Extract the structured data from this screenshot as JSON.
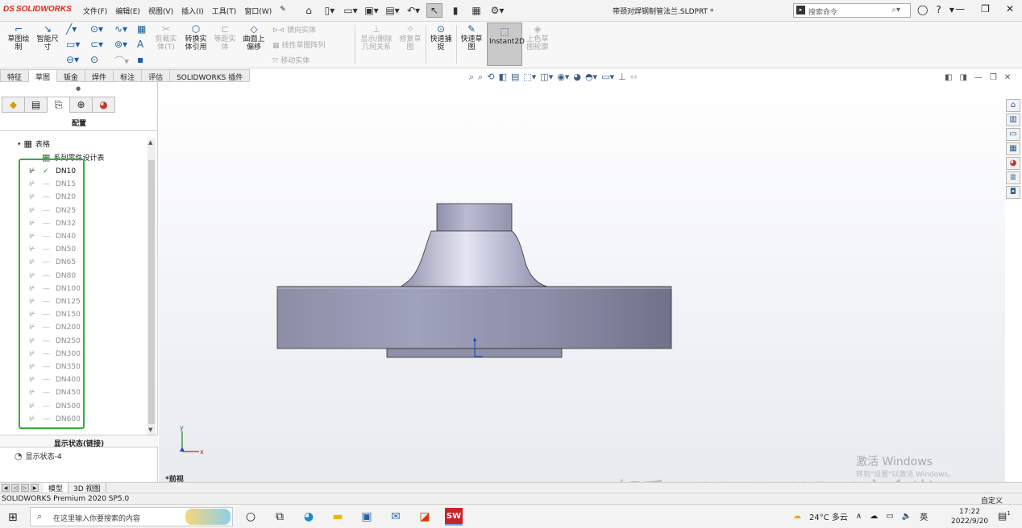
{
  "app": {
    "logo": "SOLIDWORKS",
    "menu": [
      "文件(F)",
      "编辑(E)",
      "视图(V)",
      "插入(I)",
      "工具(T)",
      "窗口(W)"
    ],
    "document_title": "带颈对焊钢制管法兰.SLDPRT *",
    "search_placeholder": "搜索命令"
  },
  "ribbon": {
    "sketch": "草图绘\n制",
    "smart_dim": "智能尺\n寸",
    "trim": "剪裁实\n体(T)",
    "convert": "转换实\n体引用",
    "offset_disabled": "等距实\n体",
    "offset_surface": "曲面上\n偏移",
    "mirror": "镜向实体",
    "linear_pattern": "线性草图阵列",
    "move": "移动实体",
    "show_delete": "显示/删除\n几何关系",
    "repair": "修复草\n图",
    "quick_snap": "快速捕\n捉",
    "rapid_sketch": "快速草\n图",
    "instant2d": "Instant2D",
    "shaded_contours": "上色草\n图轮廓"
  },
  "command_tabs": [
    "特征",
    "草图",
    "钣金",
    "焊件",
    "标注",
    "评估",
    "SOLIDWORKS 插件"
  ],
  "left_panel": {
    "title": "配置",
    "tables": "表格",
    "design_table": "系列零件设计表",
    "configs": [
      "DN10",
      "DN15",
      "DN20",
      "DN25",
      "DN32",
      "DN40",
      "DN50",
      "DN65",
      "DN80",
      "DN100",
      "DN125",
      "DN150",
      "DN200",
      "DN250",
      "DN300",
      "DN350",
      "DN400",
      "DN450",
      "DN500",
      "DN600"
    ],
    "active_config": "DN10",
    "display_states_title": "显示状态(链接)",
    "display_state": "显示状态-4"
  },
  "graphics": {
    "view_label": "*前视",
    "axis_x": "x",
    "axis_y": "y"
  },
  "bottom_tabs": [
    "模型",
    "3D 视图"
  ],
  "status": {
    "left": "SOLIDWORKS Premium 2020 SP5.0",
    "right": "自定义"
  },
  "watermark": {
    "line1": "激活 Windows",
    "line2": "转到\"设置\"以激活 Windows。",
    "zhihu": "知乎 @SOLIDWORKS文金米"
  },
  "taskbar": {
    "search_placeholder": "在这里输入你要搜索的内容",
    "weather": "24°C 多云",
    "ime": "英",
    "time": "17:22",
    "date": "2022/9/20",
    "notifications": "1"
  },
  "colors": {
    "accent": "#1b5fa6",
    "highlight_box": "#2fb03a",
    "sw_red": "#d52b1e",
    "part_body": "#8f92ad"
  }
}
